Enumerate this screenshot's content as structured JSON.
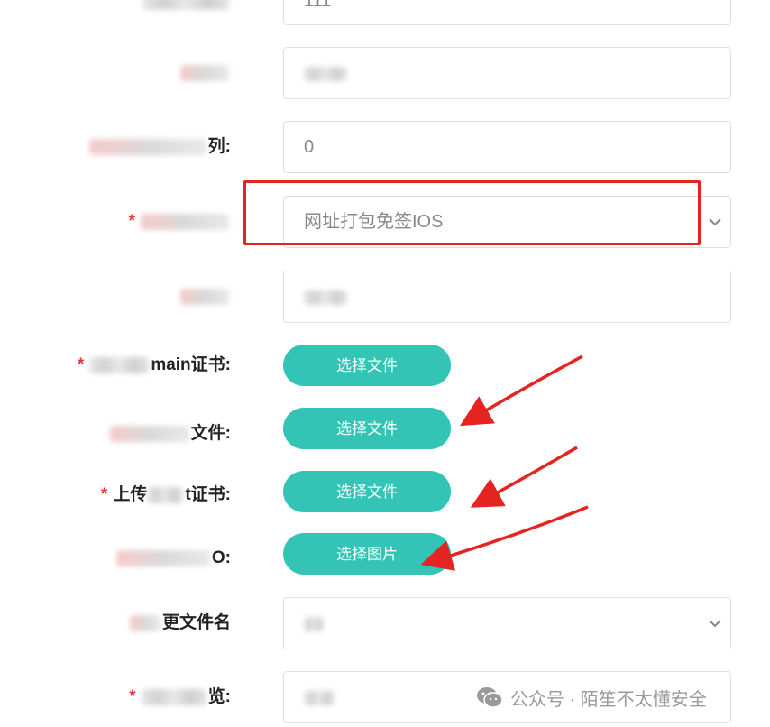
{
  "form": {
    "rows": [
      {
        "id": "row0",
        "label_suffix": "",
        "required": false,
        "field_value": "111",
        "field_type": "input"
      },
      {
        "id": "row1",
        "label_suffix": "",
        "required": false,
        "field_value": "",
        "field_type": "input"
      },
      {
        "id": "row2",
        "label_suffix": "列:",
        "required": false,
        "field_value": "0",
        "field_type": "input"
      },
      {
        "id": "row3",
        "label_suffix": "",
        "required": true,
        "field_value": "网址打包免签IOS",
        "field_type": "select"
      },
      {
        "id": "row4",
        "label_suffix": "",
        "required": false,
        "field_value": "",
        "field_type": "input"
      },
      {
        "id": "row5",
        "label_suffix": "main证书:",
        "required": true,
        "button_label": "选择文件",
        "field_type": "button"
      },
      {
        "id": "row6",
        "label_suffix": "文件:",
        "required": false,
        "button_label": "选择文件",
        "field_type": "button"
      },
      {
        "id": "row7",
        "label_prefix": "上传",
        "label_suffix": "t证书:",
        "required": true,
        "button_label": "选择文件",
        "field_type": "button"
      },
      {
        "id": "row8",
        "label_suffix": "O:",
        "required": false,
        "button_label": "选择图片",
        "field_type": "button"
      },
      {
        "id": "row9",
        "label_suffix": "更文件名",
        "required": false,
        "field_value": "",
        "field_type": "select"
      },
      {
        "id": "row10",
        "label_suffix": "览:",
        "required": true,
        "field_value": "",
        "field_type": "input"
      }
    ],
    "required_marker": "*"
  },
  "watermark": {
    "text": "公众号 · 陌笙不太懂安全",
    "icon": "wechat-icon"
  },
  "colors": {
    "accent": "#33c4b5",
    "highlight": "#e52421",
    "required": "#e53935"
  },
  "icons": {
    "select_chevron": "chevron-down-icon"
  }
}
